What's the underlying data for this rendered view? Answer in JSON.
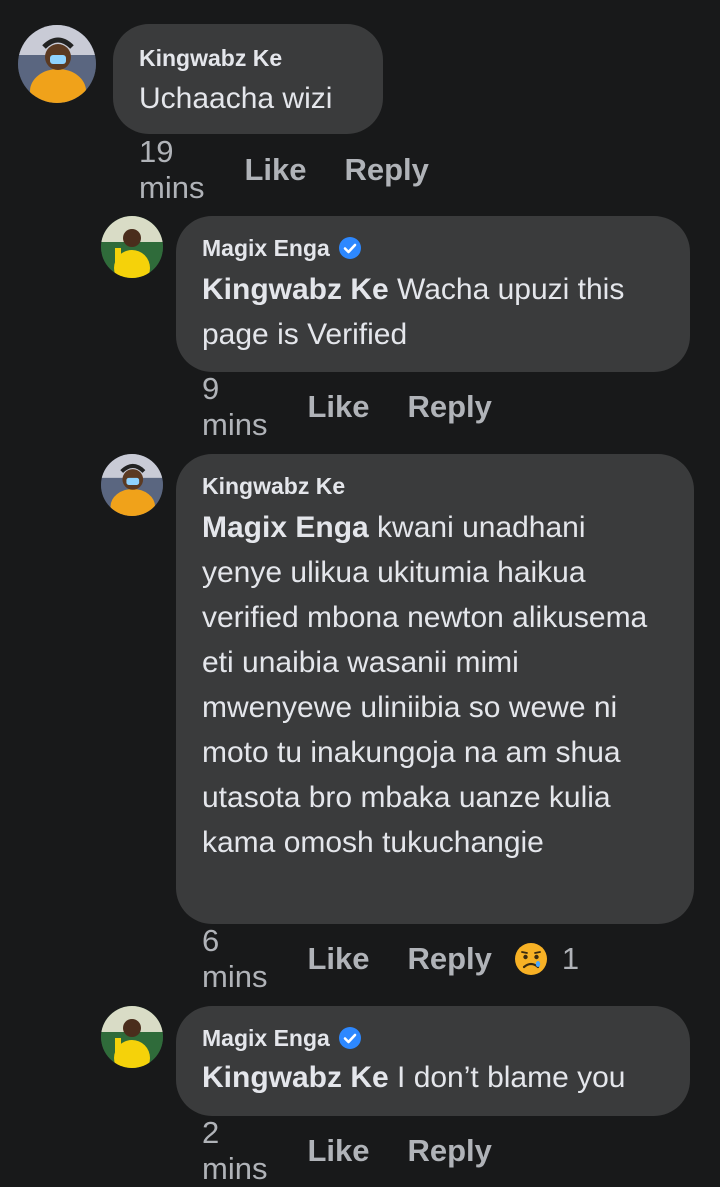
{
  "comments": [
    {
      "author": "Kingwabz Ke",
      "verified": false,
      "mention": "",
      "text": "Uchaacha wizi",
      "time": "19 mins",
      "like_label": "Like",
      "reply_label": "Reply"
    },
    {
      "author": "Magix Enga",
      "verified": true,
      "mention": "Kingwabz Ke",
      "text": " Wacha upuzi this page is Verified",
      "time": "9 mins",
      "like_label": "Like",
      "reply_label": "Reply"
    },
    {
      "author": "Kingwabz Ke",
      "verified": false,
      "mention": "Magix Enga",
      "text": " kwani unadhani yenye ulikua ukitumia haikua verified mbona newton alikusema eti unaibia wasanii mimi mwenyewe uliniibia so wewe ni moto tu inakungoja na am shua utasota bro mbaka uanze kulia kama omosh tukuchangie",
      "time": "6 mins",
      "like_label": "Like",
      "reply_label": "Reply",
      "reaction": {
        "icon": "sad-face-icon",
        "count": "1"
      }
    },
    {
      "author": "Magix Enga",
      "verified": true,
      "mention": "Kingwabz Ke",
      "text": " I don’t blame you",
      "time": "2 mins",
      "like_label": "Like",
      "reply_label": "Reply"
    }
  ],
  "colors": {
    "background": "#18191a",
    "bubble": "#3a3b3c",
    "text": "#e4e6eb",
    "meta": "#b0b3b8",
    "verified": "#2d88ff"
  }
}
